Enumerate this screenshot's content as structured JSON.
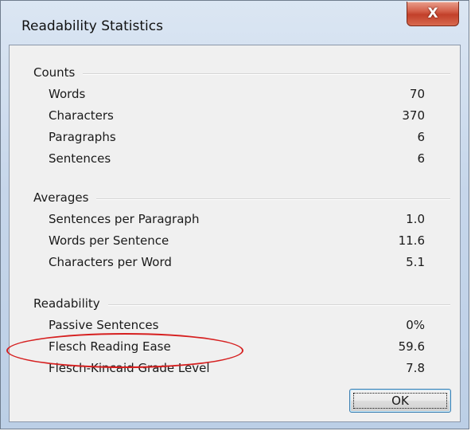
{
  "window": {
    "title": "Readability Statistics",
    "close_glyph": "X"
  },
  "groups": [
    {
      "title": "Counts",
      "rows": [
        {
          "label": "Words",
          "value": "70"
        },
        {
          "label": "Characters",
          "value": "370"
        },
        {
          "label": "Paragraphs",
          "value": "6"
        },
        {
          "label": "Sentences",
          "value": "6"
        }
      ]
    },
    {
      "title": "Averages",
      "rows": [
        {
          "label": "Sentences per Paragraph",
          "value": "1.0"
        },
        {
          "label": "Words per Sentence",
          "value": "11.6"
        },
        {
          "label": "Characters per Word",
          "value": "5.1"
        }
      ]
    },
    {
      "title": "Readability",
      "rows": [
        {
          "label": "Passive Sentences",
          "value": "0%"
        },
        {
          "label": "Flesch Reading Ease",
          "value": "59.6"
        },
        {
          "label": "Flesch-Kincaid Grade Level",
          "value": "7.8"
        }
      ]
    }
  ],
  "buttons": {
    "ok_label": "OK"
  },
  "annotation": {
    "color": "#d62020"
  }
}
